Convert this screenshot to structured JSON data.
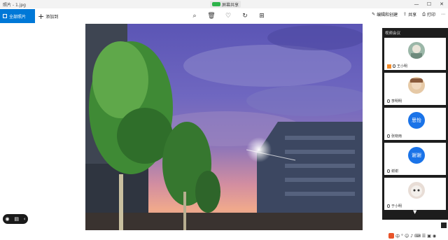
{
  "window": {
    "title": "照片 - 1.jpg",
    "recording_label": "屏幕共享",
    "controls": [
      "—",
      "☐",
      "✕"
    ]
  },
  "toolbar": {
    "collection_label": "全部照片",
    "add_label": "添加到",
    "icons": [
      "zoom-icon",
      "delete-icon",
      "favorite-icon",
      "rotate-icon",
      "crop-icon"
    ],
    "right_items": [
      "编辑和创建",
      "共享",
      "打印"
    ]
  },
  "panel": {
    "header": "视频会议",
    "participants": [
      {
        "name": "王小明",
        "avatar_text": "",
        "has_orange": true
      },
      {
        "name": "李明明",
        "avatar_text": "",
        "has_orange": false
      },
      {
        "name": "张晓雨",
        "avatar_text": "思怡",
        "has_orange": false
      },
      {
        "name": "谢谢",
        "avatar_text": "谢谢",
        "has_orange": false
      },
      {
        "name": "于小明",
        "avatar_text": "",
        "has_orange": false
      }
    ]
  },
  "taskbar": {
    "items": [
      "中",
      "°",
      "☺",
      "♪",
      "⌨",
      "☰",
      "▣",
      "◉"
    ]
  },
  "colors": {
    "accent": "#0078d7",
    "panel_bg": "#1d1d1d",
    "avatar_blue": "#1a73e8"
  }
}
